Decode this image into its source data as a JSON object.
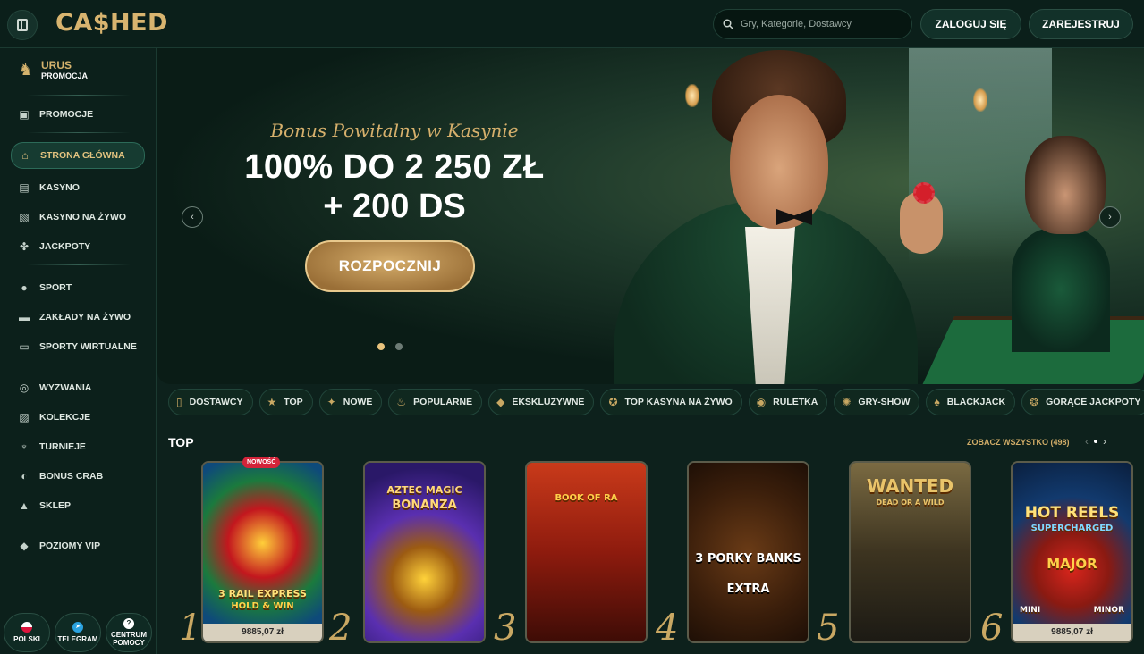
{
  "header": {
    "logo": "CA$HED",
    "search_placeholder": "Gry, Kategorie, Dostawcy",
    "login_label": "ZALOGUJ SIĘ",
    "register_label": "ZAREJESTRUJ"
  },
  "sidebar": {
    "promo": {
      "title": "URUS",
      "subtitle": "PROMOCJA"
    },
    "items": [
      {
        "label": "PROMOCJE",
        "icon": "gift-icon"
      },
      {
        "label": "STRONA GŁÓWNA",
        "icon": "home-icon",
        "active": true
      },
      {
        "label": "KASYNO",
        "icon": "slot-machine-icon"
      },
      {
        "label": "KASYNO NA ŻYWO",
        "icon": "cards-icon"
      },
      {
        "label": "JACKPOTY",
        "icon": "clover-icon"
      },
      {
        "label": "SPORT",
        "icon": "ball-icon"
      },
      {
        "label": "ZAKŁADY NA ŻYWO",
        "icon": "live-icon"
      },
      {
        "label": "SPORTY WIRTUALNE",
        "icon": "monitor-icon"
      },
      {
        "label": "WYZWANIA",
        "icon": "medal-icon"
      },
      {
        "label": "KOLEKCJE",
        "icon": "collection-icon"
      },
      {
        "label": "TURNIEJE",
        "icon": "trophy-icon"
      },
      {
        "label": "BONUS CRAB",
        "icon": "crab-icon"
      },
      {
        "label": "SKLEP",
        "icon": "shop-icon"
      },
      {
        "label": "POZIOMY VIP",
        "icon": "diamond-icon"
      }
    ],
    "bottom": {
      "language": "POLSKI",
      "telegram": "TELEGRAM",
      "help_line1": "CENTRUM",
      "help_line2": "POMOCY"
    }
  },
  "hero": {
    "subtitle": "Bonus Powitalny w Kasynie",
    "line1": "100% DO 2 250 ZŁ",
    "line2": "+ 200 DS",
    "cta": "ROZPOCZNIJ",
    "slides_total": 2,
    "active_slide": 1
  },
  "categories": [
    {
      "label": "DOSTAWCY",
      "icon": "provider-icon"
    },
    {
      "label": "TOP",
      "icon": "star-icon"
    },
    {
      "label": "NOWE",
      "icon": "new-icon"
    },
    {
      "label": "POPULARNE",
      "icon": "fire-icon"
    },
    {
      "label": "EKSKLUZYWNE",
      "icon": "diamond-icon"
    },
    {
      "label": "TOP KASYNA NA ŻYWO",
      "icon": "live-casino-icon"
    },
    {
      "label": "RULETKA",
      "icon": "roulette-icon"
    },
    {
      "label": "GRY-SHOW",
      "icon": "show-icon"
    },
    {
      "label": "BLACKJACK",
      "icon": "blackjack-icon"
    },
    {
      "label": "GORĄCE JACKPOTY",
      "icon": "jackpot-icon"
    }
  ],
  "top_section": {
    "title": "TOP",
    "see_all": "ZOBACZ WSZYSTKO (498)",
    "badge_new": "NOWOŚĆ",
    "games": [
      {
        "rank": "1",
        "title": "3 RAIL EXPRESS",
        "subtitle": "HOLD & WIN",
        "price": "9885,07 zł"
      },
      {
        "rank": "2",
        "title": "AZTEC MAGIC",
        "subtitle": "BONANZA",
        "price": ""
      },
      {
        "rank": "3",
        "title": "BOOK OF RA",
        "subtitle": "",
        "price": ""
      },
      {
        "rank": "4",
        "title": "3 PORKY BANKS",
        "subtitle": "EXTRA",
        "price": ""
      },
      {
        "rank": "5",
        "title": "WANTED",
        "subtitle": "DEAD OR A WILD",
        "price": ""
      },
      {
        "rank": "6",
        "title": "HOT REELS",
        "subtitle": "SUPERCHARGED",
        "price": "9885,07 zł",
        "extra1": "MAJOR",
        "extra2": "MINI",
        "extra3": "MINOR"
      }
    ]
  }
}
